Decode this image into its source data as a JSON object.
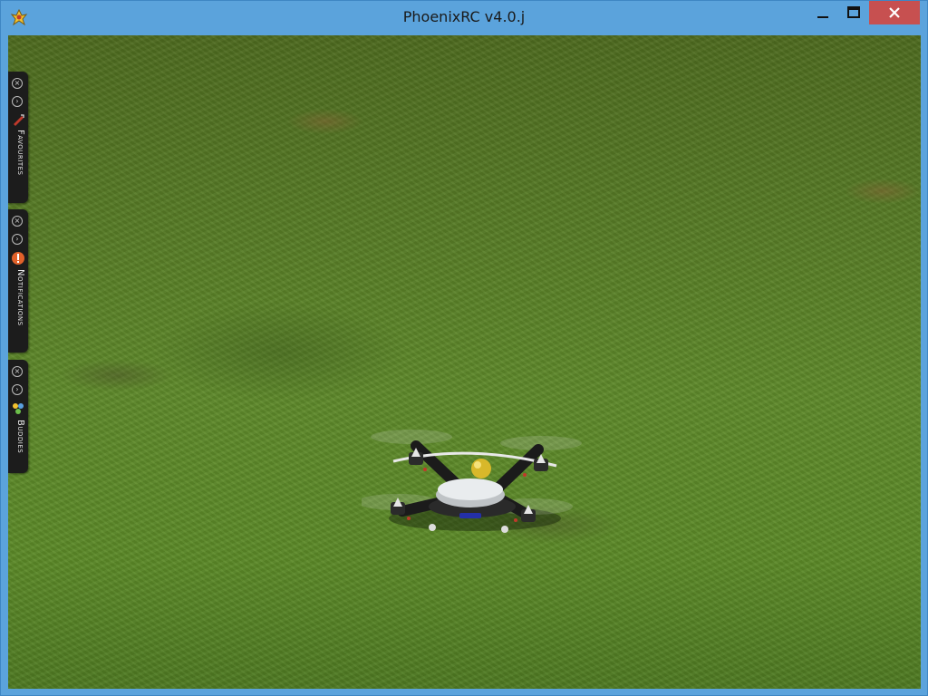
{
  "window": {
    "title": "PhoenixRC v4.0.j",
    "app_icon": "phoenix-app-icon",
    "controls": {
      "minimize": "minimize-icon",
      "maximize": "maximize-icon",
      "close": "close-icon"
    },
    "titlebar_color": "#5ba3dc",
    "close_color": "#c75050"
  },
  "sidebar_tabs": [
    {
      "label": "Favourites",
      "icon": "favourites-icon"
    },
    {
      "label": "Notifications",
      "icon": "notification-warning-icon"
    },
    {
      "label": "Buddies",
      "icon": "buddies-icon"
    }
  ],
  "scene": {
    "ground": "grass-field",
    "model": "quadcopter",
    "ground_color": "#5a8528"
  }
}
